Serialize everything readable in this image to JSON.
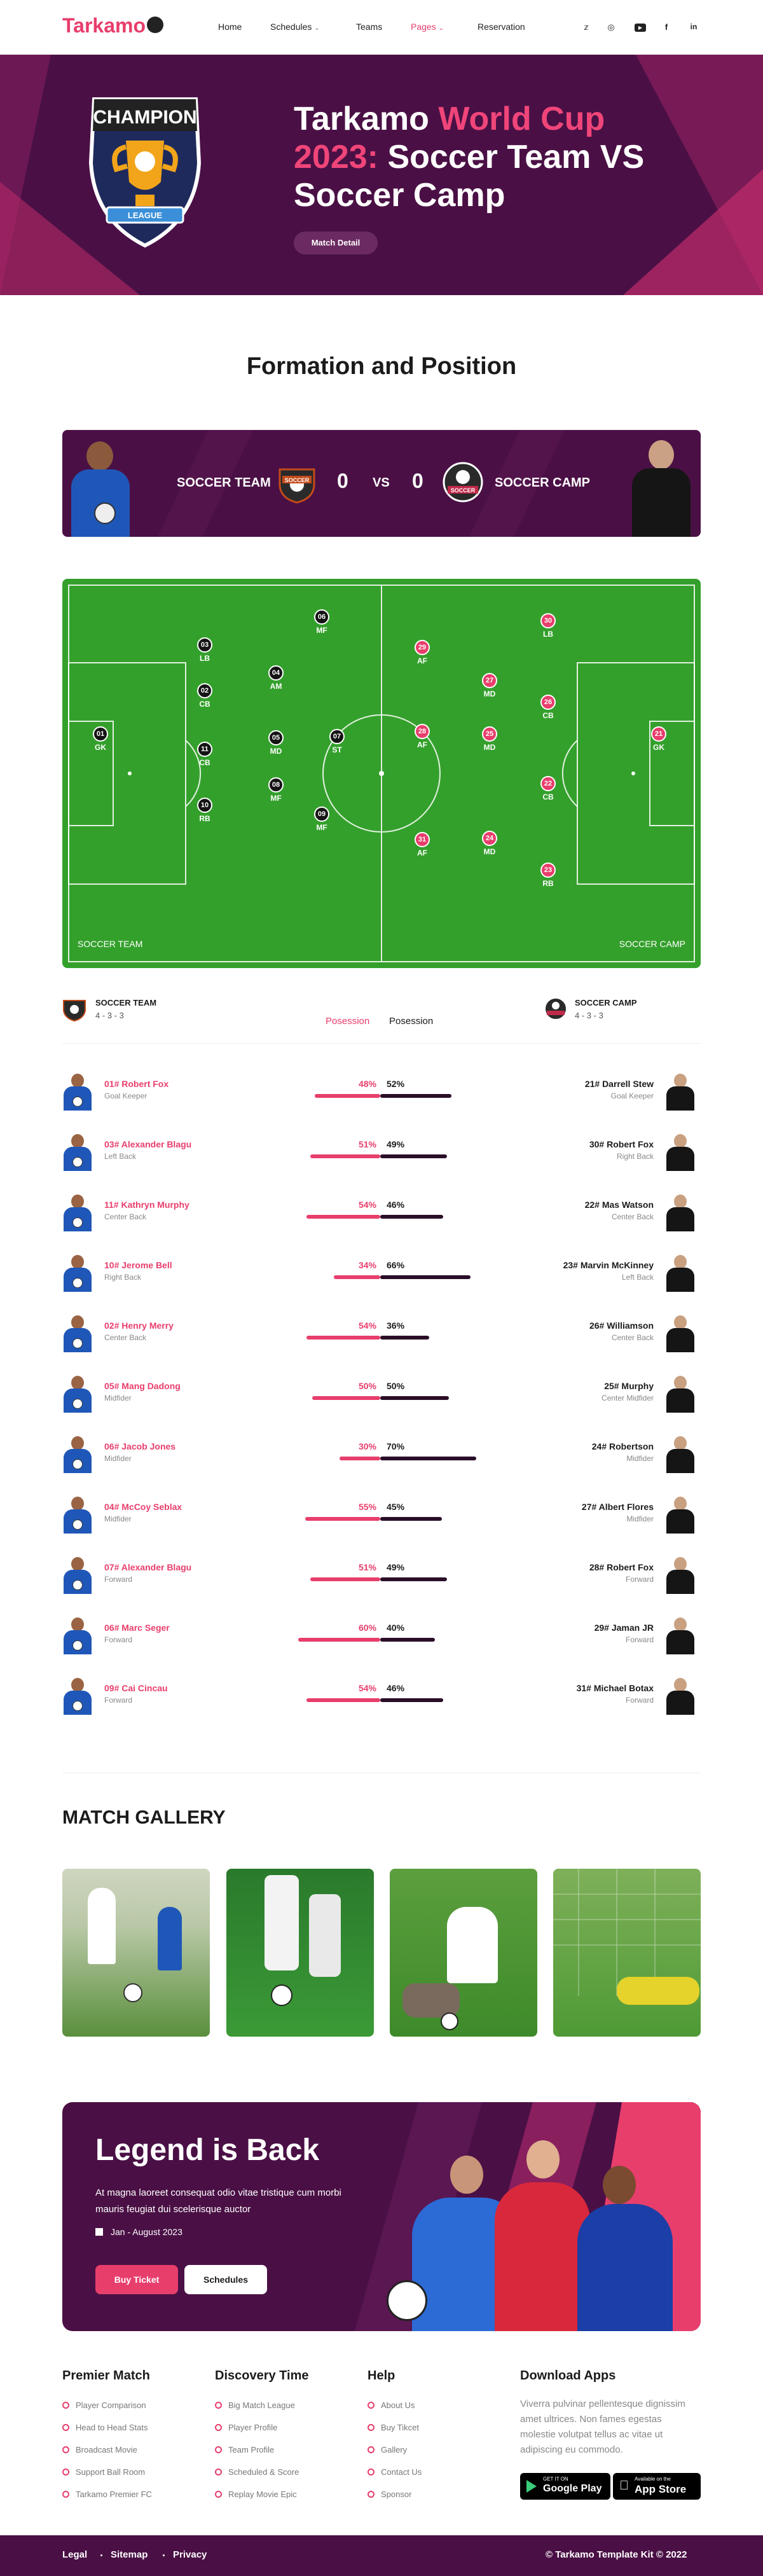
{
  "brand": {
    "name": "Tarkamo"
  },
  "nav": {
    "items": [
      "Home",
      "Schedules",
      "Teams",
      "Pages",
      "Reservation"
    ],
    "active": "Pages"
  },
  "social": [
    "twitter-icon",
    "dribbble-icon",
    "youtube-icon",
    "facebook-icon",
    "linkedin-icon"
  ],
  "hero": {
    "badge_top": "CHAMPION",
    "badge_bottom": "LEAGUE",
    "title_part1": "Tarkamo ",
    "title_pink1": "World Cup",
    "title_pink2": "2023:",
    "title_part2": " Soccer Team VS Soccer Camp",
    "button": "Match Detail"
  },
  "formation": {
    "title": "Formation and Position"
  },
  "match": {
    "team_a": "SOCCER TEAM",
    "score_a": "0",
    "vs": "VS",
    "score_b": "0",
    "team_b": "SOCCER CAMP",
    "badge_a": "SOCCER",
    "badge_b": "SOCCER"
  },
  "pitch": {
    "label_left": "SOCCER TEAM",
    "label_right": "SOCCER CAMP",
    "team_a": [
      {
        "n": "06",
        "p": "MF"
      },
      {
        "n": "03",
        "p": "LB"
      },
      {
        "n": "04",
        "p": "AM"
      },
      {
        "n": "02",
        "p": "CB"
      },
      {
        "n": "05",
        "p": "MD"
      },
      {
        "n": "01",
        "p": "GK"
      },
      {
        "n": "07",
        "p": "ST"
      },
      {
        "n": "11",
        "p": "CB"
      },
      {
        "n": "08",
        "p": "MF"
      },
      {
        "n": "10",
        "p": "RB"
      },
      {
        "n": "09",
        "p": "MF"
      }
    ],
    "team_b": [
      {
        "n": "29",
        "p": "AF"
      },
      {
        "n": "30",
        "p": "LB"
      },
      {
        "n": "27",
        "p": "MD"
      },
      {
        "n": "26",
        "p": "CB"
      },
      {
        "n": "28",
        "p": "AF"
      },
      {
        "n": "25",
        "p": "MD"
      },
      {
        "n": "21",
        "p": "GK"
      },
      {
        "n": "22",
        "p": "CB"
      },
      {
        "n": "31",
        "p": "AF"
      },
      {
        "n": "24",
        "p": "MD"
      },
      {
        "n": "23",
        "p": "RB"
      }
    ]
  },
  "teams_header": {
    "team_a": "SOCCER TEAM",
    "formation_a": "4 - 3 - 3",
    "team_b": "SOCCER CAMP",
    "formation_b": "4 - 3 - 3",
    "poss_a": "Posession",
    "poss_b": "Posession"
  },
  "players": [
    {
      "a": "01# Robert Fox",
      "ap": "Goal Keeper",
      "pa": 48,
      "pb": 52,
      "b": "21# Darrell Stew",
      "bp": "Goal Keeper"
    },
    {
      "a": "03# Alexander Blagu",
      "ap": "Left Back",
      "pa": 51,
      "pb": 49,
      "b": "30# Robert Fox",
      "bp": "Right Back"
    },
    {
      "a": "11# Kathryn Murphy",
      "ap": "Center Back",
      "pa": 54,
      "pb": 46,
      "b": "22# Mas Watson",
      "bp": "Center Back"
    },
    {
      "a": "10# Jerome Bell",
      "ap": "Right Back",
      "pa": 34,
      "pb": 66,
      "b": "23# Marvin McKinney",
      "bp": "Left Back"
    },
    {
      "a": "02# Henry Merry",
      "ap": "Center Back",
      "pa": 54,
      "pb": 36,
      "b": "26# Williamson",
      "bp": "Center Back"
    },
    {
      "a": "05# Mang Dadong",
      "ap": "Midfider",
      "pa": 50,
      "pb": 50,
      "b": "25# Murphy",
      "bp": "Center Midfider"
    },
    {
      "a": "06# Jacob Jones",
      "ap": "Midfider",
      "pa": 30,
      "pb": 70,
      "b": "24# Robertson",
      "bp": "Midfider"
    },
    {
      "a": "04# McCoy Seblax",
      "ap": "Midfider",
      "pa": 55,
      "pb": 45,
      "b": "27# Albert Flores",
      "bp": "Midfider"
    },
    {
      "a": "07# Alexander Blagu",
      "ap": "Forward",
      "pa": 51,
      "pb": 49,
      "b": "28# Robert Fox",
      "bp": "Forward"
    },
    {
      "a": "06# Marc Seger",
      "ap": "Forward",
      "pa": 60,
      "pb": 40,
      "b": "29# Jaman JR",
      "bp": "Forward"
    },
    {
      "a": "09# Cai Cincau",
      "ap": "Forward",
      "pa": 54,
      "pb": 46,
      "b": "31# Michael Botax",
      "bp": "Forward"
    }
  ],
  "gallery": {
    "title": "MATCH GALLERY"
  },
  "legend": {
    "title": "Legend is Back",
    "text": "At magna laoreet consequat odio vitae tristique cum morbi mauris feugiat dui scelerisque auctor",
    "date": "Jan - August 2023",
    "buy": "Buy Ticket",
    "schedules": "Schedules"
  },
  "footer": {
    "col1": {
      "title": "Premier Match",
      "links": [
        "Player Comparison",
        "Head to Head Stats",
        "Broadcast Movie",
        "Support Ball Room",
        "Tarkamo Premier FC"
      ]
    },
    "col2": {
      "title": "Discovery Time",
      "links": [
        "Big Match League",
        "Player Profile",
        "Team Profile",
        "Scheduled & Score",
        "Replay Movie Epic"
      ]
    },
    "col3": {
      "title": "Help",
      "links": [
        "About Us",
        "Buy Tikcet",
        "Gallery",
        "Contact Us",
        "Sponsor"
      ]
    },
    "col4": {
      "title": "Download Apps",
      "text": "Viverra pulvinar pellentesque dignissim amet ultrices. Non fames egestas molestie volutpat tellus ac vitae ut adipiscing eu commodo.",
      "gp_small": "GET IT ON",
      "gp_big": "Google Play",
      "as_small": "Available on the",
      "as_big": "App Store"
    }
  },
  "bottom": {
    "links": [
      "Legal",
      "Sitemap",
      "Privacy"
    ],
    "copy": "©  Tarkamo Template Kit © 2022"
  },
  "colors": {
    "pink": "#e83e6c",
    "purple": "#4a1045",
    "dark": "#1b1b1b",
    "pitch": "#34a02c"
  }
}
